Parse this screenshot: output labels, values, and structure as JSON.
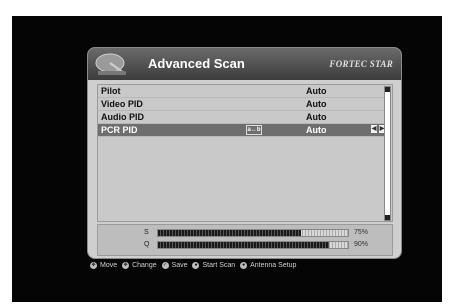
{
  "dialog": {
    "title": "Advanced Scan",
    "brand": "FORTEC STAR"
  },
  "rows": [
    {
      "label": "Pilot",
      "value": "Auto"
    },
    {
      "label": "Video PID",
      "value": "Auto"
    },
    {
      "label": "Audio PID",
      "value": "Auto"
    },
    {
      "label": "PCR PID",
      "value": "Auto",
      "selected": true,
      "keypad": "a↔b"
    }
  ],
  "signal": {
    "s": {
      "label": "S",
      "value_pct": 75,
      "text": "75%"
    },
    "q": {
      "label": "Q",
      "value_pct": 90,
      "text": "90%"
    }
  },
  "footer": {
    "move": "Move",
    "change": "Change",
    "save": "Save",
    "start_scan": "Start Scan",
    "antenna_setup": "Antenna Setup"
  }
}
